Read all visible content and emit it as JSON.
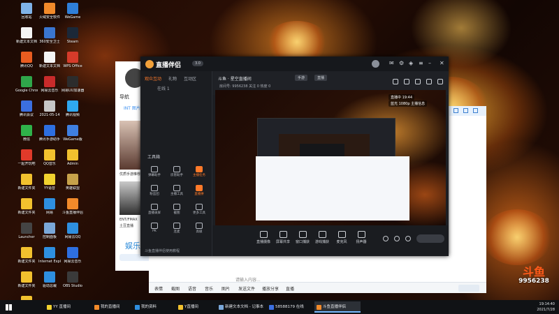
{
  "desktop_icons": [
    {
      "label": "回收站",
      "color": "#7fb3e8"
    },
    {
      "label": "火绒安全软件",
      "color": "#f28a2a"
    },
    {
      "label": "WeGame",
      "color": "#2f7fd9"
    },
    {
      "label": "新建文本文档",
      "color": "#f4f4f4"
    },
    {
      "label": "360安全卫士",
      "color": "#3a76d0"
    },
    {
      "label": "Steam",
      "color": "#1b2838"
    },
    {
      "label": "腾讯QQ",
      "color": "#e85c20"
    },
    {
      "label": "新建文本文档",
      "color": "#f4f4f4"
    },
    {
      "label": "WPS Office",
      "color": "#d53b2a"
    },
    {
      "label": "Google Chrome",
      "color": "#2fa64a"
    },
    {
      "label": "网易云音乐",
      "color": "#c92b2b"
    },
    {
      "label": "网易UU加速器",
      "color": "#2c2c2c"
    },
    {
      "label": "腾讯会议",
      "color": "#3b6fe0"
    },
    {
      "label": "2021-05-14",
      "color": "#c6c6c6"
    },
    {
      "label": "腾讯视频",
      "color": "#2fa8f0"
    },
    {
      "label": "微信",
      "color": "#2fb24a"
    },
    {
      "label": "腾讯手游助手",
      "color": "#2e6fe0"
    },
    {
      "label": "WeGame版",
      "color": "#3f7fe0"
    },
    {
      "label": "一起开玩吧",
      "color": "#e03a2a"
    },
    {
      "label": "QQ音乐",
      "color": "#f2c12e"
    },
    {
      "label": "Admin",
      "color": "#f2c12e"
    },
    {
      "label": "新建文件夹",
      "color": "#f2c12e"
    },
    {
      "label": "YY语音",
      "color": "#f2d22e"
    },
    {
      "label": "英雄联盟",
      "color": "#c7a24a"
    },
    {
      "label": "新建文件夹",
      "color": "#f2c12e"
    },
    {
      "label": "网易",
      "color": "#2e8fe0"
    },
    {
      "label": "斗鱼直播伴侣",
      "color": "#f28a2a"
    },
    {
      "label": "Launcher",
      "color": "#444444"
    },
    {
      "label": "控制面板",
      "color": "#7aa7d8"
    },
    {
      "label": "网易云QQ",
      "color": "#2e8fe0"
    },
    {
      "label": "新建文件夹",
      "color": "#f2c12e"
    },
    {
      "label": "Internet Explorer",
      "color": "#2e8fe0"
    },
    {
      "label": "网易云音乐",
      "color": "#2e6fe0"
    },
    {
      "label": "新建文件夹",
      "color": "#f2c12e"
    },
    {
      "label": "驱动总裁",
      "color": "#2e8fe0"
    },
    {
      "label": "OBS Studio",
      "color": "#3a3a3a"
    },
    {
      "label": "腾讯",
      "color": "#f2c12e"
    }
  ],
  "qq_panel": {
    "name": "导航",
    "tabs": "INT  图片",
    "captions": [
      "优质手游推荐",
      "ENT/FMAX",
      "土豆直播"
    ],
    "yule": "娱乐"
  },
  "chat_window": {
    "placeholder": "请输入内容...",
    "tools": [
      "表情",
      "截图",
      "语音",
      "音乐",
      "图片",
      "发送文件",
      "播放分享",
      "直播"
    ],
    "send_label": ""
  },
  "streamer_app": {
    "brand": "直播伴侣",
    "version": "3.0",
    "sidebar_tabs": [
      "观众互动",
      "礼物",
      "互动区"
    ],
    "online_label": "在线 1",
    "toolbox_title": "工具箱",
    "tools": [
      {
        "label": "弹幕助手",
        "hot": false
      },
      {
        "label": "房管助手",
        "hot": false
      },
      {
        "label": "主播任务",
        "hot": true
      },
      {
        "label": "粉丝团",
        "hot": false
      },
      {
        "label": "主播工具",
        "hot": false
      },
      {
        "label": "直播拼",
        "hot": true
      },
      {
        "label": "直播录屏",
        "hot": false
      },
      {
        "label": "截图",
        "hot": false
      },
      {
        "label": "更多工具",
        "hot": false
      },
      {
        "label": "PK",
        "hot": false
      },
      {
        "label": "连麦",
        "hot": false
      },
      {
        "label": "高级",
        "hot": false
      }
    ],
    "sidebar_footer": "斗鱼直播伴侣使用教程",
    "header": {
      "room": "斗鱼 · 星空直播间",
      "category": "手游",
      "pill": "直播",
      "row2": "房间号: 9956238    关注 0    热度 0"
    },
    "preview_badges": [
      "直播中 19:44",
      "蓝光 1080p 主播信息"
    ],
    "bottom_tools": [
      "直播摄像",
      "屏幕共享",
      "窗口捕获",
      "游戏捕获",
      "麦克风",
      "扬声器"
    ]
  },
  "watermark": {
    "logo": "斗鱼",
    "room_id": "9956238"
  },
  "taskbar": {
    "items": [
      {
        "label": "YY 直播间",
        "color": "#f2d22e",
        "active": false
      },
      {
        "label": "我的直播间",
        "color": "#f28a2a",
        "active": false
      },
      {
        "label": "我的资料",
        "color": "#2e8fe0",
        "active": false
      },
      {
        "label": "Y直播间",
        "color": "#f2c12e",
        "active": false
      },
      {
        "label": "新建文本文档 - 记事本",
        "color": "#7aa7d8",
        "active": false
      },
      {
        "label": "58588179 在线",
        "color": "#3b6fe0",
        "active": false
      },
      {
        "label": "斗鱼直播伴侣",
        "color": "#f28a2a",
        "active": true
      }
    ],
    "time": "19:14:40",
    "date": "2021/7/28"
  }
}
